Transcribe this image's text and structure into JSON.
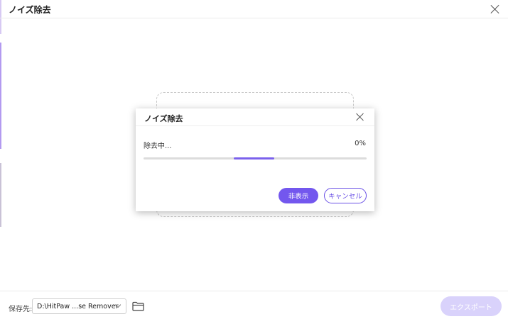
{
  "app": {
    "title": "ノイズ除去"
  },
  "dialog": {
    "title": "ノイズ除去",
    "status_text": "除去中...",
    "percent_text": "0%",
    "progress": 0,
    "hide_label": "非表示",
    "cancel_label": "キャンセル"
  },
  "footer": {
    "save_label": "保存先:",
    "path_value": "D:\\HitPaw ...se Remover",
    "export_label": "エクスポート"
  },
  "colors": {
    "accent": "#7357ee",
    "export_disabled": "#d9d2fb"
  }
}
